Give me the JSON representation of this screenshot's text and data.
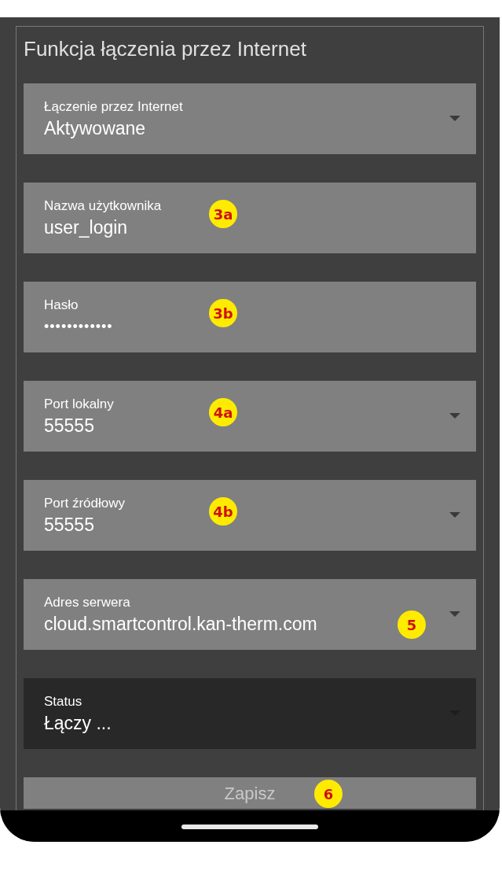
{
  "title": "Funkcja łączenia przez Internet",
  "fields": [
    {
      "kind": "dropdown",
      "label": "Łączenie przez Internet",
      "value": "Aktywowane",
      "disabled": false
    },
    {
      "kind": "text",
      "label": "Nazwa użytkownika",
      "value": "user_login",
      "disabled": false,
      "badge": "3a"
    },
    {
      "kind": "password",
      "label": "Hasło",
      "value": "••••••••••••",
      "disabled": false,
      "badge": "3b"
    },
    {
      "kind": "dropdown",
      "label": "Port lokalny",
      "value": "55555",
      "disabled": false,
      "badge": "4a"
    },
    {
      "kind": "dropdown",
      "label": "Port źródłowy",
      "value": "55555",
      "disabled": false,
      "badge": "4b"
    },
    {
      "kind": "dropdown",
      "label": "Adres serwera",
      "value": "cloud.smartcontrol.kan-therm.com",
      "disabled": false,
      "badge": "5"
    },
    {
      "kind": "dropdown",
      "label": "Status",
      "value": "Łączy ...",
      "disabled": true
    }
  ],
  "save_button": {
    "label": "Zapisz",
    "badge": "6"
  }
}
